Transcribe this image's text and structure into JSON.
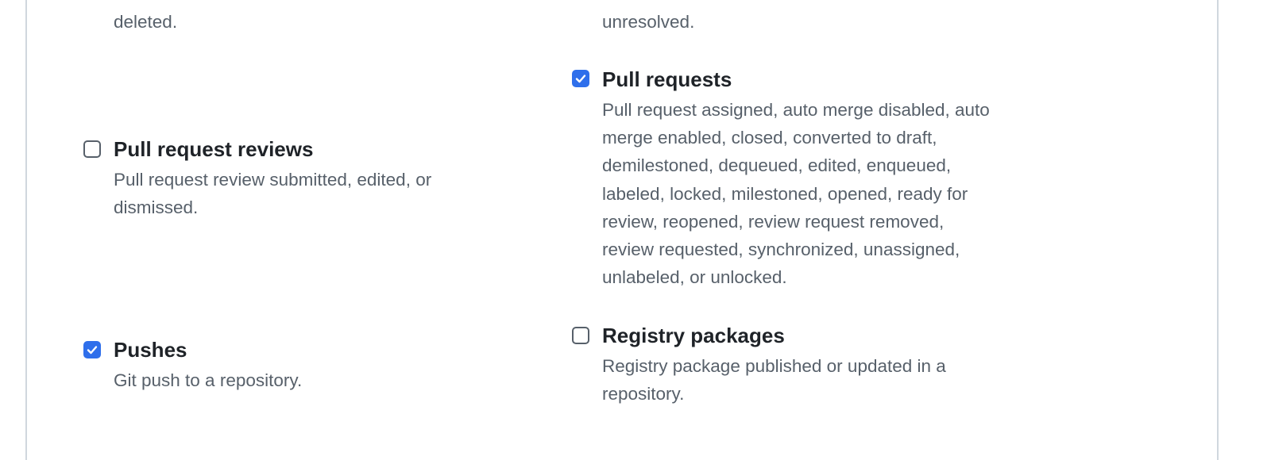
{
  "partial_top": {
    "left_desc_tail": "deleted.",
    "right_desc_tail": "unresolved."
  },
  "events": {
    "pull_requests": {
      "title": "Pull requests",
      "checked": true,
      "description_lines": [
        "Pull request assigned, auto merge disabled, auto",
        "merge enabled, closed, converted to draft,",
        "demilestoned, dequeued, edited, enqueued,",
        "labeled, locked, milestoned, opened, ready for",
        "review, reopened, review request removed,",
        "review requested, synchronized, unassigned,",
        "unlabeled, or unlocked."
      ]
    },
    "pull_request_reviews": {
      "title": "Pull request reviews",
      "checked": false,
      "description_lines": [
        "Pull request review submitted, edited, or",
        "dismissed."
      ]
    },
    "pushes": {
      "title": "Pushes",
      "checked": true,
      "description_lines": [
        "Git push to a repository."
      ]
    },
    "registry_packages": {
      "title": "Registry packages",
      "checked": false,
      "description_lines": [
        "Registry package published or updated in a",
        "repository."
      ]
    }
  },
  "colors": {
    "checkbox_checked": "#2f6feb",
    "title_text": "#1f2328",
    "description_text": "#57606a",
    "border": "#d0d7de"
  }
}
